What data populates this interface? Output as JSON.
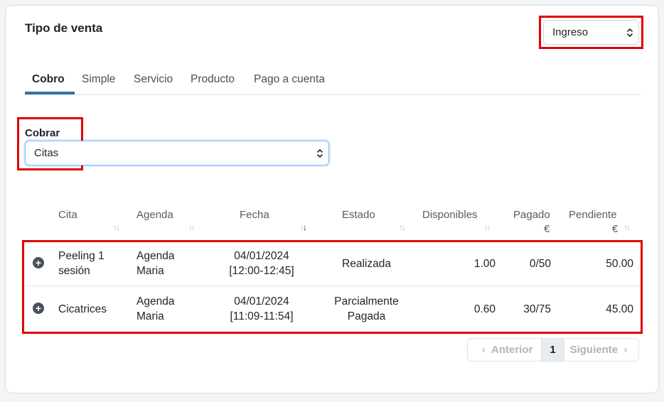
{
  "card": {
    "title": "Tipo de venta"
  },
  "tipo_select": {
    "value": "Ingreso"
  },
  "tabs": [
    {
      "label": "Cobro",
      "active": true
    },
    {
      "label": "Simple"
    },
    {
      "label": "Servicio"
    },
    {
      "label": "Producto"
    },
    {
      "label": "Pago a cuenta"
    }
  ],
  "cobrar": {
    "label": "Cobrar",
    "value": "Citas"
  },
  "table": {
    "headers": {
      "cita": "Cita",
      "agenda": "Agenda",
      "fecha": "Fecha",
      "estado": "Estado",
      "disponibles": "Disponibles",
      "pagado": "Pagado",
      "pagado_unit": "€",
      "pendiente": "Pendiente",
      "pendiente_unit": "€"
    },
    "sorted_column": "fecha",
    "rows": [
      {
        "cita_line1": "Peeling 1",
        "cita_line2": "sesión",
        "agenda_line1": "Agenda",
        "agenda_line2": "Maria",
        "fecha_line1": "04/01/2024",
        "fecha_line2": "[12:00-12:45]",
        "estado_line1": "Realizada",
        "estado_line2": "",
        "disponibles": "1.00",
        "pagado": "0/50",
        "pendiente": "50.00"
      },
      {
        "cita_line1": "Cicatrices",
        "cita_line2": "",
        "agenda_line1": "Agenda",
        "agenda_line2": "Maria",
        "fecha_line1": "04/01/2024",
        "fecha_line2": "[11:09-11:54]",
        "estado_line1": "Parcialmente",
        "estado_line2": "Pagada",
        "disponibles": "0.60",
        "pagado": "30/75",
        "pendiente": "45.00"
      }
    ]
  },
  "pagination": {
    "prev": "Anterior",
    "current": "1",
    "next": "Siguiente"
  },
  "colors": {
    "highlight": "#e00000",
    "tab_active": "#3a6fa8"
  }
}
